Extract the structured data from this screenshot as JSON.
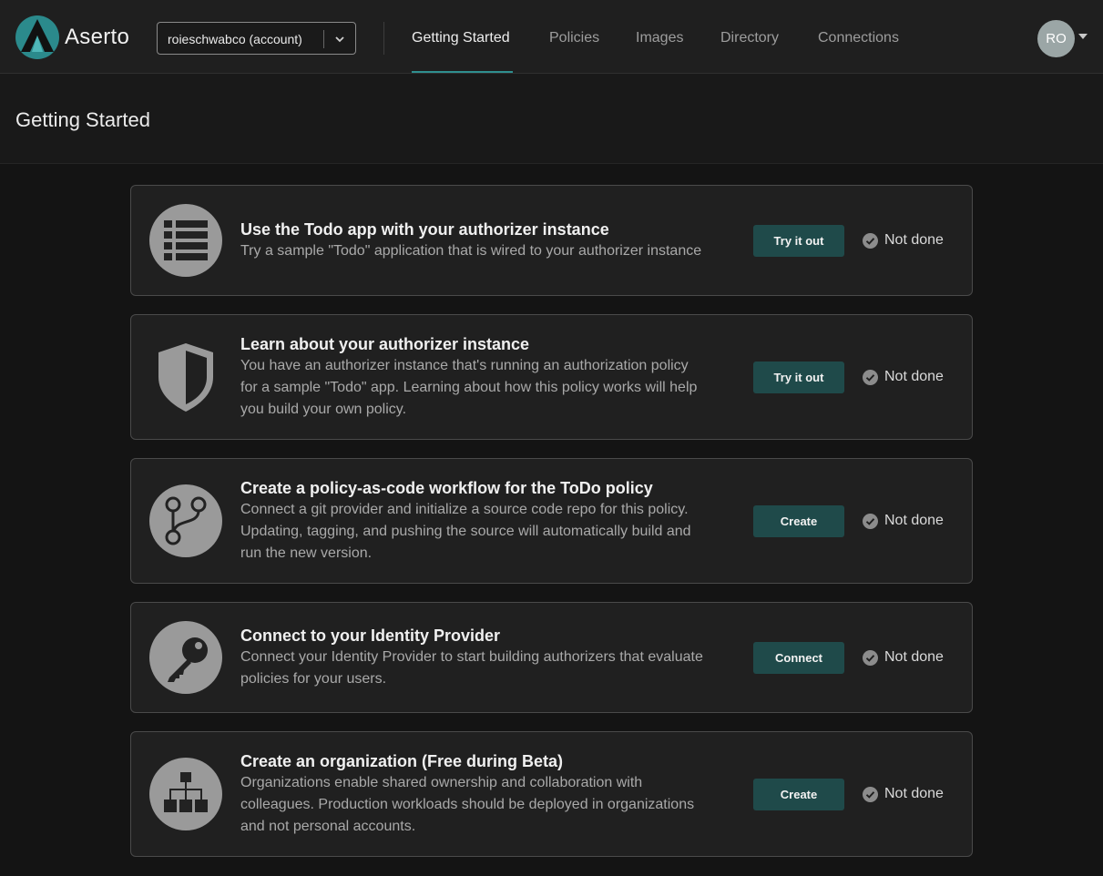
{
  "header": {
    "brand": "Aserto",
    "account_selector": "roieschwabco (account)",
    "nav": [
      "Getting Started",
      "Policies",
      "Images",
      "Directory",
      "Connections"
    ],
    "active_nav": "Getting Started",
    "avatar_initials": "RO"
  },
  "page_title": "Getting Started",
  "colors": {
    "accent": "#2f8f8f",
    "button": "#1f4a4a",
    "background": "#141414",
    "card": "#202020"
  },
  "tasks": [
    {
      "icon": "list-icon",
      "title": "Use the Todo app with your authorizer instance",
      "lines": [
        "Try a sample \"Todo\" application that is wired to your authorizer instance"
      ],
      "button": "Try it out",
      "status": "Not done"
    },
    {
      "icon": "shield-icon",
      "title": "Learn about your authorizer instance",
      "lines": [
        "You have an authorizer instance that's running an authorization policy",
        "for a sample \"Todo\" app. Learning about how this policy works will help",
        "you build your own policy."
      ],
      "button": "Try it out",
      "status": "Not done"
    },
    {
      "icon": "git-branch-icon",
      "title": "Create a policy-as-code workflow for the ToDo policy",
      "lines": [
        "Connect a git provider and initialize a source code repo for this policy.",
        "Updating, tagging, and pushing the source will automatically build and",
        "run the new version."
      ],
      "button": "Create",
      "status": "Not done"
    },
    {
      "icon": "key-icon",
      "title": "Connect to your Identity Provider",
      "lines": [
        "Connect your Identity Provider to start building authorizers that evaluate",
        "policies for your users."
      ],
      "button": "Connect",
      "status": "Not done"
    },
    {
      "icon": "org-chart-icon",
      "title": "Create an organization (Free during Beta)",
      "lines": [
        "Organizations enable shared ownership and collaboration with",
        "colleagues. Production workloads should be deployed in organizations",
        "and not personal accounts."
      ],
      "button": "Create",
      "status": "Not done"
    }
  ]
}
